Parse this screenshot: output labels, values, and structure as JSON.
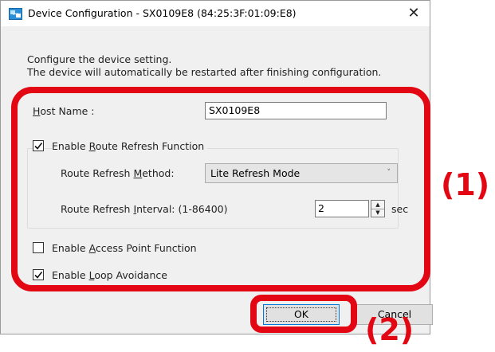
{
  "window": {
    "title": "Device Configuration - SX0109E8 (84:25:3F:01:09:E8)",
    "close_glyph": "✕"
  },
  "intro": {
    "line1": "Configure the device setting.",
    "line2": "The device will automatically be restarted after finishing configuration."
  },
  "host_name": {
    "label_pre": "",
    "label_u": "H",
    "label_post": "ost Name :",
    "value": "SX0109E8"
  },
  "route_refresh": {
    "enabled": true,
    "label_pre": "Enable ",
    "label_u": "R",
    "label_post": "oute Refresh Function",
    "method": {
      "label_pre": "Route Refresh ",
      "label_u": "M",
      "label_post": "ethod:",
      "value": "Lite Refresh Mode"
    },
    "interval": {
      "label_pre": "Route Refresh ",
      "label_u": "I",
      "label_post": "nterval: (1-86400)",
      "value": "2",
      "unit": "sec"
    }
  },
  "access_point": {
    "enabled": false,
    "label_pre": "Enable ",
    "label_u": "A",
    "label_post": "ccess Point Function"
  },
  "loop_avoidance": {
    "enabled": true,
    "label_pre": "Enable ",
    "label_u": "L",
    "label_post": "oop Avoidance"
  },
  "buttons": {
    "ok": "OK",
    "cancel": "Cancel"
  },
  "annotations": {
    "label1": "(1)",
    "label2": "(2)",
    "color": "#e30613"
  },
  "icons": {
    "app": "device-config-icon",
    "check": "checkmark-icon",
    "spin_up": "▲",
    "spin_down": "▼",
    "combo_arrow": "˅"
  }
}
